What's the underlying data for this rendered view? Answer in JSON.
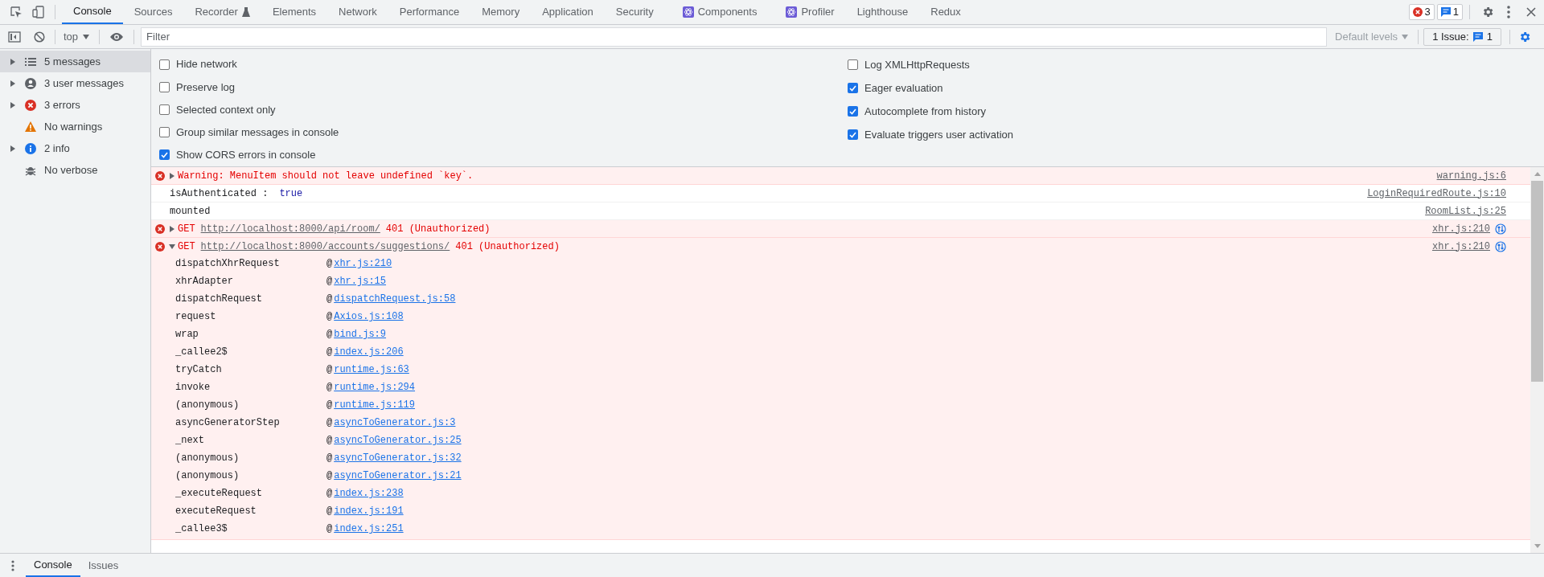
{
  "tabs": [
    {
      "label": "Console",
      "selected": true,
      "kind": "plain"
    },
    {
      "label": "Sources",
      "selected": false,
      "kind": "plain"
    },
    {
      "label": "Recorder",
      "selected": false,
      "kind": "experiment"
    },
    {
      "label": "Elements",
      "selected": false,
      "kind": "plain"
    },
    {
      "label": "Network",
      "selected": false,
      "kind": "plain"
    },
    {
      "label": "Performance",
      "selected": false,
      "kind": "plain"
    },
    {
      "label": "Memory",
      "selected": false,
      "kind": "plain"
    },
    {
      "label": "Application",
      "selected": false,
      "kind": "plain"
    },
    {
      "label": "Security",
      "selected": false,
      "kind": "plain"
    },
    {
      "label": "Components",
      "selected": false,
      "kind": "extension"
    },
    {
      "label": "Profiler",
      "selected": false,
      "kind": "extension"
    },
    {
      "label": "Lighthouse",
      "selected": false,
      "kind": "plain"
    },
    {
      "label": "Redux",
      "selected": false,
      "kind": "plain"
    }
  ],
  "counters": {
    "errors": "3",
    "issues": "1"
  },
  "toolbar": {
    "context": "top",
    "filter_placeholder": "Filter",
    "levels": "Default levels",
    "issues_label": "1 Issue:",
    "issues_count": "1"
  },
  "sidebar": [
    {
      "label": "5 messages",
      "kind": "list",
      "expandable": true,
      "selected": true
    },
    {
      "label": "3 user messages",
      "kind": "user",
      "expandable": true,
      "selected": false
    },
    {
      "label": "3 errors",
      "kind": "error",
      "expandable": true,
      "selected": false
    },
    {
      "label": "No warnings",
      "kind": "warning",
      "expandable": false,
      "selected": false
    },
    {
      "label": "2 info",
      "kind": "info",
      "expandable": true,
      "selected": false
    },
    {
      "label": "No verbose",
      "kind": "verbose",
      "expandable": false,
      "selected": false
    }
  ],
  "settings_left": [
    {
      "label": "Hide network",
      "checked": false
    },
    {
      "label": "Preserve log",
      "checked": false
    },
    {
      "label": "Selected context only",
      "checked": false
    },
    {
      "label": "Group similar messages in console",
      "checked": false
    },
    {
      "label": "Show CORS errors in console",
      "checked": true
    }
  ],
  "settings_right": [
    {
      "label": "Log XMLHttpRequests",
      "checked": false
    },
    {
      "label": "Eager evaluation",
      "checked": true
    },
    {
      "label": "Autocomplete from history",
      "checked": true
    },
    {
      "label": "Evaluate triggers user activation",
      "checked": true
    }
  ],
  "messages": [
    {
      "kind": "error",
      "expanded": false,
      "text": "Warning: MenuItem should not leave undefined `key`.",
      "source": "warning.js:6"
    },
    {
      "kind": "log",
      "text": "isAuthenticated :",
      "value": "true",
      "source": "LoginRequiredRoute.js:10"
    },
    {
      "kind": "log",
      "text": "mounted",
      "source": "RoomList.js:25"
    },
    {
      "kind": "network",
      "expanded": false,
      "method": "GET",
      "url": "http://localhost:8000/api/room/",
      "status": "401 (Unauthorized)",
      "source": "xhr.js:210"
    },
    {
      "kind": "network",
      "expanded": true,
      "method": "GET",
      "url": "http://localhost:8000/accounts/suggestions/",
      "status": "401 (Unauthorized)",
      "source": "xhr.js:210",
      "stack": [
        {
          "fn": "dispatchXhrRequest",
          "at": "@",
          "loc": "xhr.js:210"
        },
        {
          "fn": "xhrAdapter",
          "at": "@",
          "loc": "xhr.js:15"
        },
        {
          "fn": "dispatchRequest",
          "at": "@",
          "loc": "dispatchRequest.js:58"
        },
        {
          "fn": "request",
          "at": "@",
          "loc": "Axios.js:108"
        },
        {
          "fn": "wrap",
          "at": "@",
          "loc": "bind.js:9"
        },
        {
          "fn": "_callee2$",
          "at": "@",
          "loc": "index.js:206"
        },
        {
          "fn": "tryCatch",
          "at": "@",
          "loc": "runtime.js:63"
        },
        {
          "fn": "invoke",
          "at": "@",
          "loc": "runtime.js:294"
        },
        {
          "fn": "(anonymous)",
          "at": "@",
          "loc": "runtime.js:119"
        },
        {
          "fn": "asyncGeneratorStep",
          "at": "@",
          "loc": "asyncToGenerator.js:3"
        },
        {
          "fn": "_next",
          "at": "@",
          "loc": "asyncToGenerator.js:25"
        },
        {
          "fn": "(anonymous)",
          "at": "@",
          "loc": "asyncToGenerator.js:32"
        },
        {
          "fn": "(anonymous)",
          "at": "@",
          "loc": "asyncToGenerator.js:21"
        },
        {
          "fn": "_executeRequest",
          "at": "@",
          "loc": "index.js:238"
        },
        {
          "fn": "executeRequest",
          "at": "@",
          "loc": "index.js:191"
        },
        {
          "fn": "_callee3$",
          "at": "@",
          "loc": "index.js:251"
        }
      ]
    }
  ],
  "drawer_tabs": [
    {
      "label": "Console",
      "selected": true
    },
    {
      "label": "Issues",
      "selected": false
    }
  ]
}
